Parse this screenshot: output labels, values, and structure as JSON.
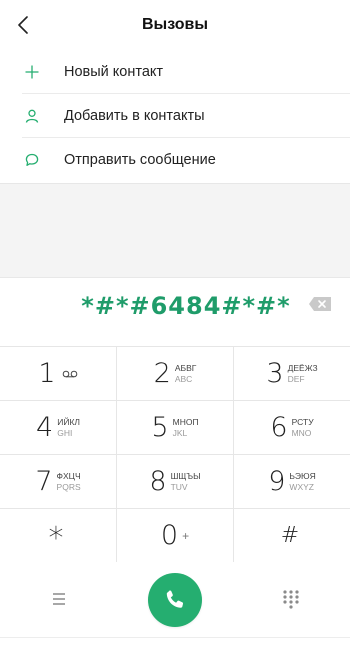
{
  "header": {
    "title": "Вызовы"
  },
  "menu": {
    "items": [
      {
        "label": "Новый контакт",
        "icon": "plus-icon"
      },
      {
        "label": "Добавить в контакты",
        "icon": "person-icon"
      },
      {
        "label": "Отправить сообщение",
        "icon": "message-icon"
      }
    ]
  },
  "dialer": {
    "number": "*#*#6484#*#*"
  },
  "keypad": {
    "keys": [
      {
        "digit": "1",
        "cyr": "",
        "lat": ""
      },
      {
        "digit": "2",
        "cyr": "АБВГ",
        "lat": "ABC"
      },
      {
        "digit": "3",
        "cyr": "ДЕЁЖЗ",
        "lat": "DEF"
      },
      {
        "digit": "4",
        "cyr": "ИЙКЛ",
        "lat": "GHI"
      },
      {
        "digit": "5",
        "cyr": "МНОП",
        "lat": "JKL"
      },
      {
        "digit": "6",
        "cyr": "РСТУ",
        "lat": "MNO"
      },
      {
        "digit": "7",
        "cyr": "ФХЦЧ",
        "lat": "PQRS"
      },
      {
        "digit": "8",
        "cyr": "ШЩЪЫ",
        "lat": "TUV"
      },
      {
        "digit": "9",
        "cyr": "ЬЭЮЯ",
        "lat": "WXYZ"
      },
      {
        "digit": "*",
        "cyr": "",
        "lat": ""
      },
      {
        "digit": "0",
        "cyr": "",
        "lat": ""
      },
      {
        "digit": "#",
        "cyr": "",
        "lat": ""
      }
    ],
    "zero_extra": "+"
  },
  "colors": {
    "accent": "#25ae70",
    "number_text": "#1f9c6a"
  }
}
